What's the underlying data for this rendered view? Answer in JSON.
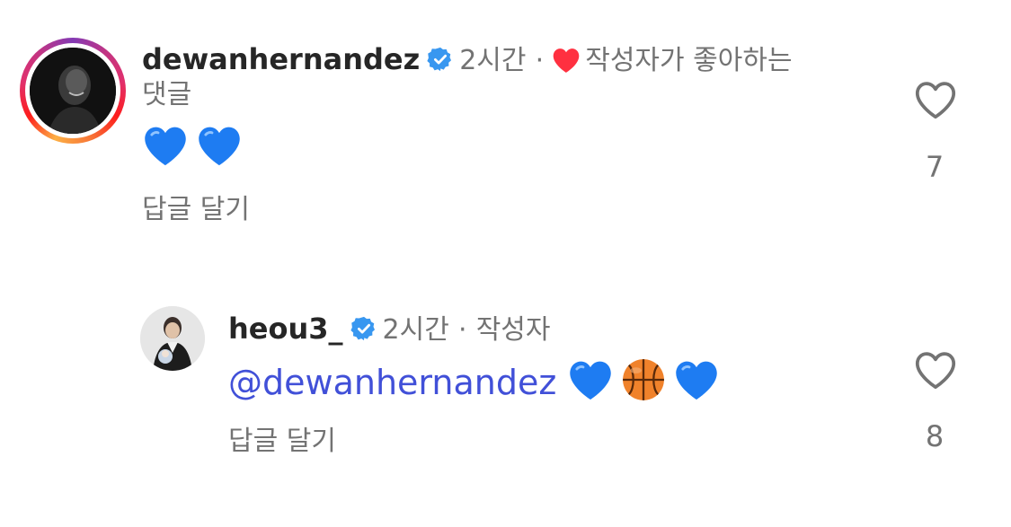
{
  "comments": [
    {
      "username": "dewanhernandez",
      "time": "2시간",
      "separator": "·",
      "liked_label": "작성자가 좋아하는",
      "liked_label_cont": "댓글",
      "body_emojis": [
        "blue-heart",
        "blue-heart"
      ],
      "reply_label": "답글 달기",
      "like_count": "7"
    },
    {
      "username": "heou3_",
      "time": "2시간",
      "separator": "·",
      "author_tag": "작성자",
      "mention": "@dewanhernandez",
      "body_emojis": [
        "blue-heart",
        "basketball",
        "blue-heart"
      ],
      "reply_label": "답글 달기",
      "like_count": "8"
    }
  ],
  "colors": {
    "verified_badge": "#3897f0",
    "liked_heart": "#ff3040",
    "blue_heart": "#1e7cf2",
    "mention": "#4150d8",
    "secondary_text": "#737373"
  }
}
